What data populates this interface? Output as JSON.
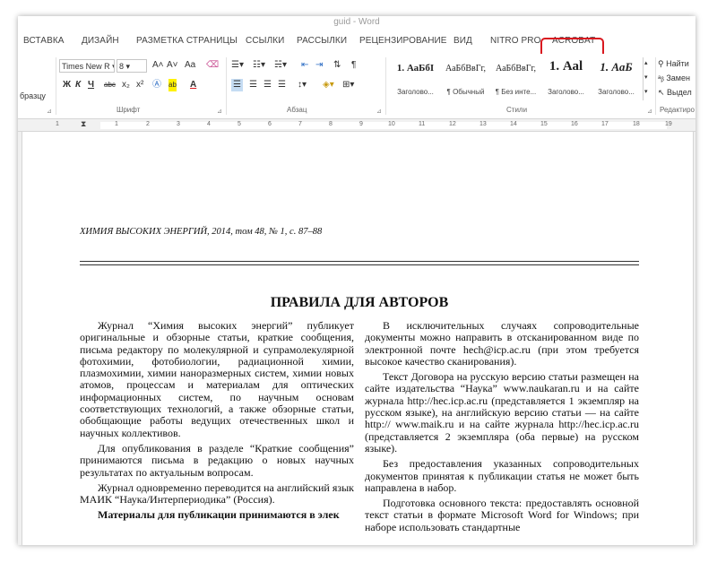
{
  "window": {
    "title": "guid - Word"
  },
  "tabs": [
    "ВСТАВКА",
    "ДИЗАЙН",
    "РАЗМЕТКА СТРАНИЦЫ",
    "ССЫЛКИ",
    "РАССЫЛКИ",
    "РЕЦЕНЗИРОВАНИЕ",
    "ВИД",
    "NITRO PRO",
    "ACROBAT"
  ],
  "highlight_color": "#d9181f",
  "ribbon": {
    "clipboard": {
      "format_painter_label": "бразцу"
    },
    "font": {
      "group_label": "Шрифт",
      "font_name": "Times New R",
      "font_size": "8",
      "grow_label": "A˄",
      "shrink_label": "A˅",
      "case_label": "Aa",
      "bold": "Ж",
      "italic": "К",
      "underline": "Ч",
      "strike": "abc",
      "subscript": "x₂",
      "superscript": "x²",
      "color_label": "A",
      "font_color": "#d9181f"
    },
    "paragraph": {
      "group_label": "Абзац",
      "pilcrow": "¶"
    },
    "styles": {
      "group_label": "Стили",
      "items": [
        {
          "sample": "1. АаБбІ",
          "name": "Заголово..."
        },
        {
          "sample": "АаБбВвГг,",
          "name": "¶ Обычный"
        },
        {
          "sample": "АаБбВвГг,",
          "name": "¶ Без инте..."
        },
        {
          "sample": "1. Ааl",
          "name": "Заголово..."
        },
        {
          "sample": "1. АаБ",
          "name": "Заголово..."
        }
      ]
    },
    "editing": {
      "group_label": "Редактиро",
      "find_label": "Найти",
      "replace_label": "Замен",
      "select_label": "Выдел"
    }
  },
  "ruler": {
    "left_numbers": [
      "1",
      "1",
      "2",
      "3",
      "4",
      "5",
      "6",
      "7",
      "8",
      "9",
      "10",
      "11",
      "12",
      "13",
      "14",
      "15",
      "16",
      "17",
      "18",
      "19"
    ]
  },
  "document": {
    "journal_line": "ХИМИЯ ВЫСОКИХ ЭНЕРГИЙ, 2014, том 48, № 1, с. 87–88",
    "title": "ПРАВИЛА ДЛЯ АВТОРОВ",
    "left_paragraphs": [
      "Журнал “Химия высоких энергий” публикует оригинальные и обзорные статьи, краткие сообщения, письма редактору по молекулярной и супрамолекулярной фотохимии, фотобиологии, радиационной химии, плазмохимии, химии наноразмерных систем, химии новых атомов, процессам и материалам для оптических информационных систем, по научным основам соответствующих технологий, а также обзорные статьи, обобщающие работы ведущих отечественных школ и научных коллективов.",
      "Для опубликования в разделе “Краткие сообщения” принимаются письма в редакцию о новых научных результатах по актуальным вопросам.",
      "Журнал одновременно переводится на английский язык МАИК “Наука/Интерпериодика” (Россия).",
      "Материалы для публикации принимаются в элек"
    ],
    "right_paragraphs": [
      "В исключительных случаях сопроводительные документы можно направить в отсканированном виде по электронной почте hech@icp.ac.ru (при этом требуется высокое качество сканирования).",
      "Текст Договора на русскую версию статьи размещен на сайте издательства “Наука” www.naukaran.ru и на сайте журнала http://hec.icp.ac.ru (представляется 1 экземпляр на русском языке), на английскую версию статьи — на сайте http:// www.maik.ru и на сайте журнала http://hec.icp.ac.ru (представляется 2 экземпляра (оба первые) на русском языке).",
      "Без предоставления указанных сопроводительных документов принятая к публикации статья не может быть направлена в набор.",
      "Подготовка основного текста: предоставлять основной текст статьи в формате Microsoft Word for Windows; при наборе использовать стандартные"
    ]
  }
}
